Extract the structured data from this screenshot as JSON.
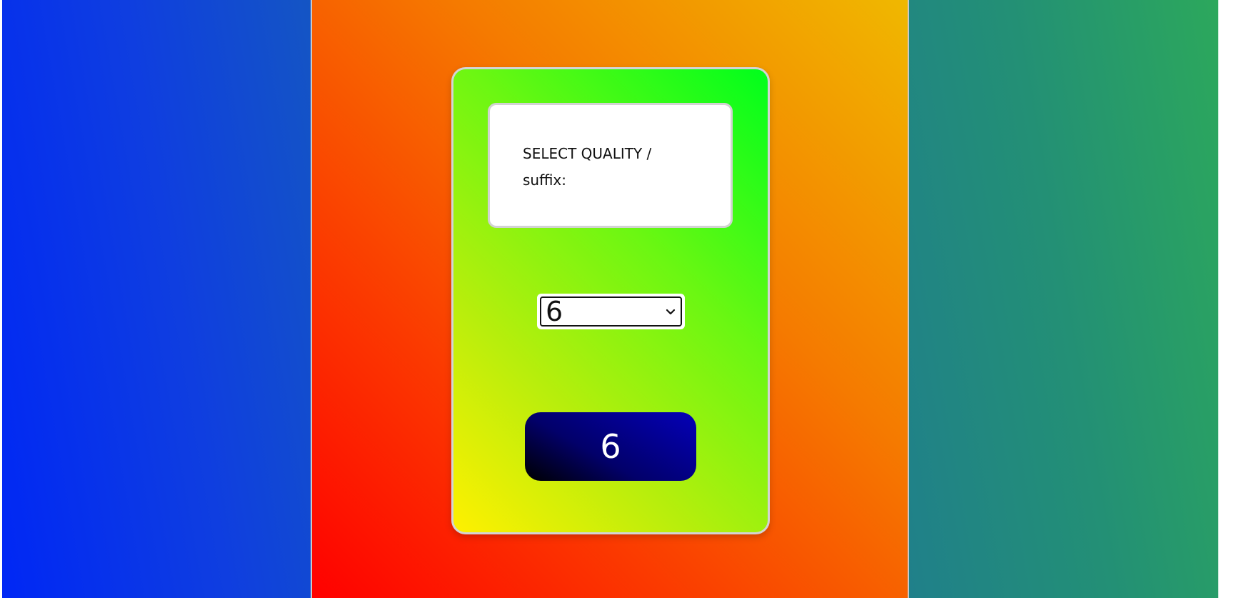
{
  "card": {
    "label": "SELECT QUALITY / suffix:",
    "select": {
      "selected_value": "6"
    },
    "button_label": "6"
  },
  "colors": {
    "left_panel": "#0f3ee0",
    "center_panel": "#f57a00",
    "right_panel": "#239075",
    "card_gradient_start": "#fff000",
    "card_gradient_end": "#00ff1c",
    "button": "#02006a"
  },
  "icons": {
    "select_arrow": "chevron-down-icon"
  }
}
